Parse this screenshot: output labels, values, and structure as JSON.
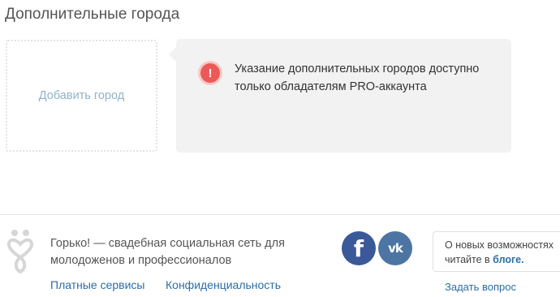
{
  "section": {
    "title": "Дополнительные города"
  },
  "add_city": {
    "label": "Добавить город"
  },
  "notice": {
    "icon_symbol": "!",
    "icon": "alert-icon",
    "text": "Указание дополнительных городов доступно только обладателям PRO-аккаунта"
  },
  "footer": {
    "logo": "gorko-logo",
    "description": "Горько! — свадебная социальная сеть для молодоженов и профессионалов",
    "links": {
      "paid": "Платные сервисы",
      "privacy": "Конфиденциальность"
    },
    "social": {
      "facebook": "f",
      "vk": "vk"
    },
    "blog": {
      "line1": "О новых возможностях",
      "line2_prefix": "читайте в",
      "link": "блоге."
    },
    "ask": "Задать вопрос"
  },
  "colors": {
    "link": "#2b6da6",
    "alert": "#ec5a58",
    "facebook": "#3b5998",
    "vk": "#4c75a3"
  }
}
